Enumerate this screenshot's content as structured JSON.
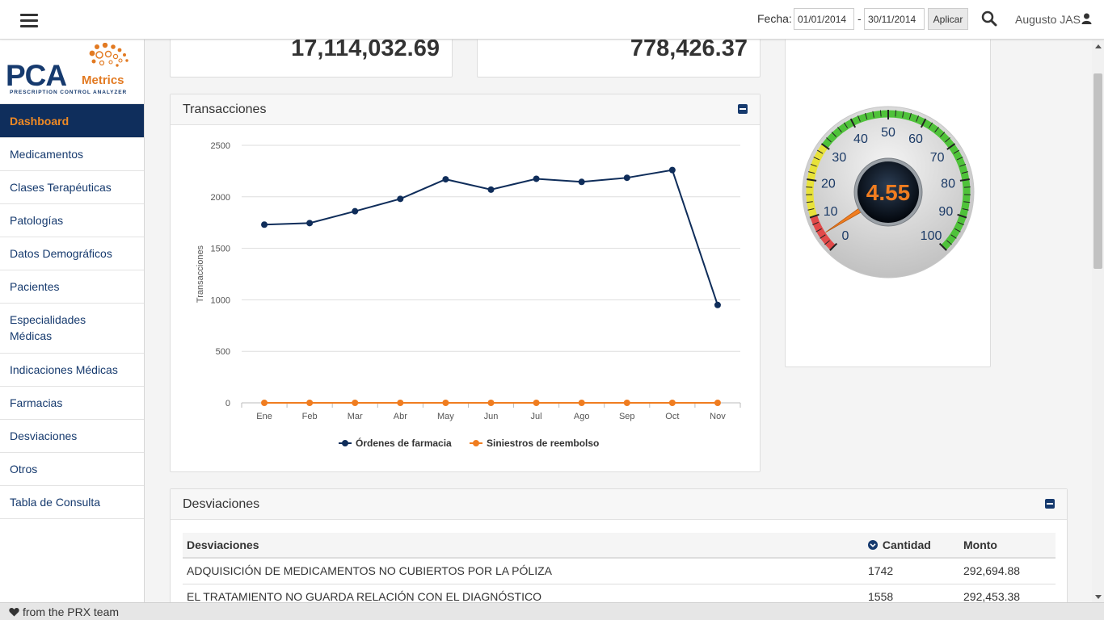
{
  "topbar": {
    "fecha_label": "Fecha:",
    "date_from": "01/01/2014",
    "date_separator": "-",
    "date_to": "30/11/2014",
    "apply_label": "Aplicar",
    "user_name": "Augusto JAS",
    "icons": [
      "menu-icon",
      "search-icon",
      "user-icon"
    ]
  },
  "logo": {
    "brand_main": "PCA",
    "brand_secondary": "Metrics",
    "tagline": "PRESCRIPTION CONTROL ANALYZER",
    "colors": {
      "primary": "#163a6e",
      "accent": "#e27a22"
    }
  },
  "sidebar": {
    "items": [
      {
        "label": "Dashboard",
        "active": true
      },
      {
        "label": "Medicamentos"
      },
      {
        "label": "Clases Terapéuticas"
      },
      {
        "label": "Patologías"
      },
      {
        "label": "Datos Demográficos"
      },
      {
        "label": "Pacientes"
      },
      {
        "label": "Especialidades Médicas"
      },
      {
        "label": "Indicaciones Médicas"
      },
      {
        "label": "Farmacias"
      },
      {
        "label": "Desviaciones"
      },
      {
        "label": "Otros"
      },
      {
        "label": "Tabla de Consulta"
      }
    ]
  },
  "stats": {
    "value_1": "17,114,032.69",
    "value_2": "778,426.37"
  },
  "transactions_card": {
    "title": "Transacciones"
  },
  "chart_data": {
    "type": "line",
    "title": "",
    "xlabel": "",
    "ylabel": "Transacciones",
    "categories": [
      "Ene",
      "Feb",
      "Mar",
      "Abr",
      "May",
      "Jun",
      "Jul",
      "Ago",
      "Sep",
      "Oct",
      "Nov"
    ],
    "ylim": [
      0,
      2500
    ],
    "yticks": [
      "0",
      "500",
      "1000",
      "1500",
      "2000",
      "2500"
    ],
    "grid": true,
    "legend_position": "bottom",
    "series": [
      {
        "name": "Órdenes de farmacia",
        "color": "#0f2d5a",
        "values": [
          1730,
          1745,
          1860,
          1980,
          2170,
          2070,
          2175,
          2145,
          2185,
          2260,
          950
        ]
      },
      {
        "name": "Siniestros de reembolso",
        "color": "#f07d20",
        "values": [
          0,
          0,
          0,
          0,
          0,
          0,
          0,
          0,
          0,
          0,
          0
        ]
      }
    ]
  },
  "gauge": {
    "value": "4.55",
    "min": 0,
    "max": 100,
    "ticks": [
      "0",
      "10",
      "20",
      "30",
      "40",
      "50",
      "60",
      "70",
      "80",
      "90",
      "100"
    ],
    "bands": [
      {
        "from": 0,
        "to": 10,
        "color": "#e24a4a"
      },
      {
        "from": 10,
        "to": 30,
        "color": "#e8e23a"
      },
      {
        "from": 30,
        "to": 100,
        "color": "#4fc23a"
      }
    ],
    "value_color": "#f07d20"
  },
  "deviations_card": {
    "title": "Desviaciones",
    "columns": [
      "Desviaciones",
      "Cantidad",
      "Monto"
    ],
    "sort_icon": "chevron-down-circle-icon",
    "rows": [
      [
        "ADQUISICIÓN DE MEDICAMENTOS NO CUBIERTOS POR LA PÓLIZA",
        "1742",
        "292,694.88"
      ],
      [
        "EL TRATAMIENTO NO GUARDA RELACIÓN CON EL DIAGNÓSTICO",
        "1558",
        "292,453.38"
      ]
    ]
  },
  "footer": {
    "text": "from the PRX team",
    "icon": "heart-icon"
  }
}
